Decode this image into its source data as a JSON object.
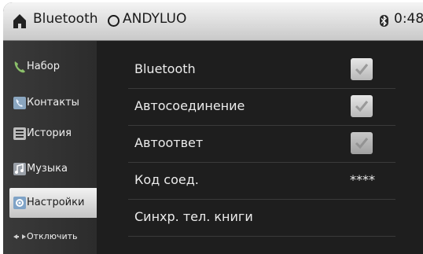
{
  "statusbar": {
    "title": "Bluetooth",
    "device_name": "ANDYLUO",
    "time": "0:48"
  },
  "sidebar": {
    "items": [
      {
        "label": "Набор",
        "icon": "phone-icon"
      },
      {
        "label": "Контакты",
        "icon": "contacts-icon"
      },
      {
        "label": "История",
        "icon": "history-icon"
      },
      {
        "label": "Музыка",
        "icon": "music-icon"
      },
      {
        "label": "Настройки",
        "icon": "settings-icon",
        "active": true
      },
      {
        "label": "Отключить",
        "icon": "disconnect-icon"
      }
    ]
  },
  "settings": {
    "rows": [
      {
        "label": "Bluetooth",
        "checked": true
      },
      {
        "label": "Автосоединение",
        "checked": true
      },
      {
        "label": "Автоответ",
        "checked": true
      },
      {
        "label": "Код соед.",
        "value": "****"
      },
      {
        "label": "Синхр. тел. книги"
      }
    ]
  },
  "colors": {
    "background": "#1e1e1e",
    "statusbar": "#d8d8d8",
    "active_item": "#e0e0e0",
    "text": "#ececec"
  }
}
